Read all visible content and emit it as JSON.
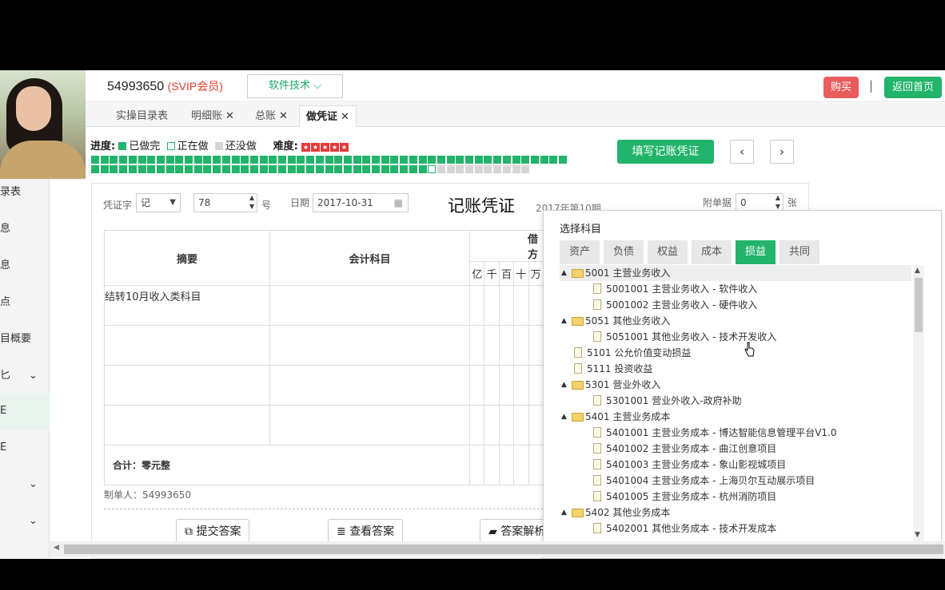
{
  "header": {
    "user_id": "54993650",
    "member": "(SVIP会员)",
    "software_menu": "软件技术",
    "buy": "购买",
    "separator": "|",
    "home": "返回首页"
  },
  "tabs": [
    {
      "label": "实操目录表",
      "closable": false
    },
    {
      "label": "明细账",
      "closable": true
    },
    {
      "label": "总账",
      "closable": true
    },
    {
      "label": "做凭证",
      "closable": true,
      "active": true
    }
  ],
  "left_nav": [
    "录表",
    "息",
    "息",
    "点",
    "目概要",
    "匕",
    "E",
    "E"
  ],
  "progress": {
    "label": "进度:",
    "done": "已做完",
    "doing": "正在做",
    "todo": "还没做",
    "difficulty_label": "难度:",
    "difficulty_stars": 5,
    "total": 98,
    "done_count": 87,
    "current_index": 88
  },
  "actions": {
    "fill": "填写记账凭证",
    "prev": "‹",
    "next": "›"
  },
  "voucher": {
    "type_label": "凭证字",
    "type_value": "记",
    "number": "78",
    "number_unit": "号",
    "date_label": "日期",
    "date_value": "2017-10-31",
    "title": "记账凭证",
    "period": "2017年第10期",
    "attach_label": "附单据",
    "attach_value": "0",
    "attach_unit": "张",
    "col_summary": "摘要",
    "col_account": "会计科目",
    "col_debit": "借方",
    "digit_headers": [
      "亿",
      "千",
      "百",
      "十",
      "万"
    ],
    "rows": [
      {
        "summary": "结转10月收入类科目",
        "account": ""
      },
      {
        "summary": "",
        "account": ""
      },
      {
        "summary": "",
        "account": ""
      },
      {
        "summary": "",
        "account": ""
      }
    ],
    "total": "合计：零元整",
    "maker": "制单人：54993650",
    "btn_submit": "提交答案",
    "btn_view": "查看答案",
    "btn_explain": "答案解析"
  },
  "subject_picker": {
    "title": "选择科目",
    "tabs": [
      "资产",
      "负债",
      "权益",
      "成本",
      "损益",
      "共同"
    ],
    "active_tab": "损益",
    "nodes": [
      {
        "text": "5001 主营业务收入",
        "level": 0,
        "type": "folder",
        "highlight": true
      },
      {
        "text": "5001001 主营业务收入 - 软件收入",
        "level": 1,
        "type": "file"
      },
      {
        "text": "5001002 主营业务收入 - 硬件收入",
        "level": 1,
        "type": "file"
      },
      {
        "text": "5051 其他业务收入",
        "level": 0,
        "type": "folder"
      },
      {
        "text": "5051001 其他业务收入 - 技术开发收入",
        "level": 1,
        "type": "file"
      },
      {
        "text": "5101 公允价值变动损益",
        "level": 0,
        "type": "file"
      },
      {
        "text": "5111 投资收益",
        "level": 0,
        "type": "file"
      },
      {
        "text": "5301 营业外收入",
        "level": 0,
        "type": "folder"
      },
      {
        "text": "5301001 营业外收入-政府补助",
        "level": 1,
        "type": "file"
      },
      {
        "text": "5401 主营业务成本",
        "level": 0,
        "type": "folder"
      },
      {
        "text": "5401001 主营业务成本 - 博达智能信息管理平台V1.0",
        "level": 1,
        "type": "file"
      },
      {
        "text": "5401002 主营业务成本 - 曲江创意项目",
        "level": 1,
        "type": "file"
      },
      {
        "text": "5401003 主营业务成本 - 象山影视城项目",
        "level": 1,
        "type": "file"
      },
      {
        "text": "5401004 主营业务成本 - 上海贝尔互动展示项目",
        "level": 1,
        "type": "file"
      },
      {
        "text": "5401005 主营业务成本 - 杭州消防项目",
        "level": 1,
        "type": "file"
      },
      {
        "text": "5402 其他业务成本",
        "level": 0,
        "type": "folder"
      },
      {
        "text": "5402001 其他业务成本 - 技术开发成本",
        "level": 1,
        "type": "file"
      }
    ]
  },
  "colors": {
    "accent": "#22b46b",
    "danger": "#e85c5c",
    "done": "#22b46b",
    "todo": "#d5d5d5"
  }
}
